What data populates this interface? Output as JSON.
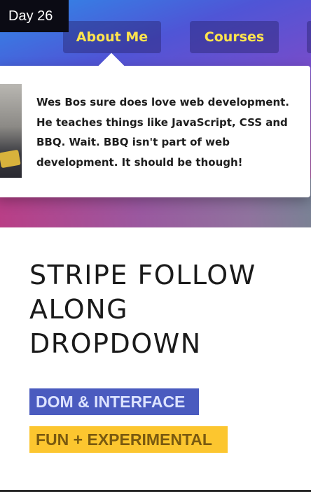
{
  "badge": {
    "label": "Day 26"
  },
  "nav": {
    "items": [
      {
        "label": "About Me"
      },
      {
        "label": "Courses"
      },
      {
        "label": ""
      }
    ]
  },
  "dropdown": {
    "text": "Wes Bos sure does love web development. He teaches things like JavaScript, CSS and BBQ. Wait. BBQ isn't part of web development. It should be though!"
  },
  "page": {
    "title": "Stripe Follow Along Dropdown"
  },
  "tags": [
    {
      "label": "DOM & Interface",
      "color": "#4a5bbf"
    },
    {
      "label": "Fun + Experimental",
      "color": "#fcc62f"
    }
  ],
  "colors": {
    "nav_text": "#ffe44d",
    "badge_bg": "#0b0b14"
  }
}
